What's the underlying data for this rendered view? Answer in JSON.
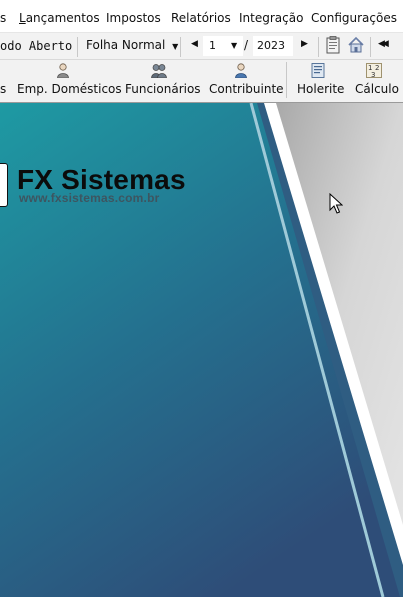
{
  "menu": {
    "items": [
      "s",
      "Lançamentos",
      "Impostos",
      "Relatórios",
      "Integração",
      "Configurações"
    ]
  },
  "toolbar1": {
    "period_status": "odo Aberto",
    "payroll_type": "Folha Normal",
    "month": "1",
    "separator": "/",
    "year": "2023"
  },
  "toolbar2": {
    "buttons": [
      {
        "label": "s",
        "icon": "cut-off-icon"
      },
      {
        "label": "Emp. Domésticos",
        "icon": "domestic-worker-icon"
      },
      {
        "label": "Funcionários",
        "icon": "employees-icon"
      },
      {
        "label": "Contribuinte",
        "icon": "taxpayer-icon"
      },
      {
        "label": "Holerite",
        "icon": "payslip-icon"
      },
      {
        "label": "Cálculo",
        "icon": "calculation-icon"
      }
    ]
  },
  "banner": {
    "title": "FX Sistemas",
    "url": "www.fxsistemas.com.br"
  },
  "colors": {
    "teal_light": "#1f8f9e",
    "blue_dark": "#2d4f78",
    "gray_panel": "#c9c9c9",
    "menu_bg": "#ffffff",
    "toolbar_bg": "#f2f2f2"
  }
}
